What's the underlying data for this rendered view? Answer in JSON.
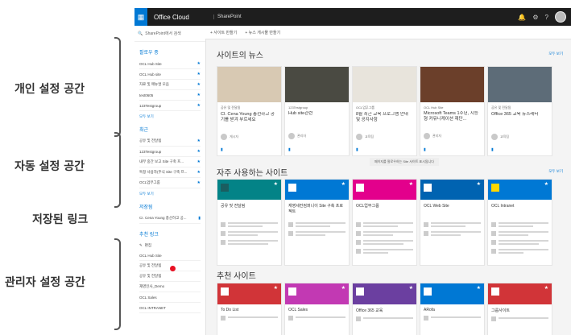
{
  "annotations": [
    {
      "label": "개인 설정 공간"
    },
    {
      "label": "자동 설정 공간"
    },
    {
      "label": "저장된 링크"
    },
    {
      "label": "관리자 설정 공간"
    }
  ],
  "topbar": {
    "brand": "Office Cloud",
    "site_title": "SharePoint",
    "icon_names": [
      "waffle-icon",
      "bell-icon",
      "gear-icon",
      "help-icon",
      "avatar"
    ]
  },
  "sidebar": {
    "search_placeholder": "SharePoint에서 검색",
    "following": {
      "title": "팔로우 중",
      "items": [
        "OCL Hub Site",
        "OCL Hub site",
        "자료 및 매뉴얼 모음",
        "test0605",
        "123Testgroup"
      ],
      "more": "모두 보기"
    },
    "recent": {
      "title": "최근",
      "items": [
        "공유 및 전달됨",
        "123Testgroup",
        "내부 중간 보고 Site 구축 프...",
        "특정 사용자(주식 Site 구축 프...",
        "OCL업무그룹"
      ],
      "more": "모두 보기"
    },
    "saved": {
      "title": "저장됨",
      "items": [
        "CI. Cena Young 총선하고 공..."
      ]
    },
    "featured": {
      "title": "추천 링크",
      "edit": "편집",
      "items": [
        "OCL Hub Site",
        "공유 및 전달됨",
        "공유 및 전달됨",
        "재영인사_Demo",
        "OCL Sales",
        "OCL INTRANET"
      ]
    }
  },
  "cmdbar": {
    "create_site": "+ 사이트 만들기",
    "create_news": "+ 뉴스 게시물 만들기"
  },
  "news": {
    "title": "사이트의 뉴스",
    "see_all": "모두 보기",
    "cards": [
      {
        "tag": "공유 및 전달됨",
        "title": "CI. Cena Young 총선하고 공기를 받겨 부르세요",
        "author": "게시자",
        "color": "#d8c9b3"
      },
      {
        "tag": "123Testgroup",
        "title": "Hub site관련",
        "author": "관리자",
        "color": "#4a4a42"
      },
      {
        "tag": "OCL업무그룹",
        "title": "8월 최근 교육 프로그램 안내 및 공지사항",
        "author": "교육팀",
        "color": "#e8e4dc"
      },
      {
        "tag": "OCL Hub Site",
        "title": "Microsoft Teams 1주년, 지능형 커뮤니케이션 재단...",
        "author": "관리자",
        "color": "#6b3f2a"
      },
      {
        "tag": "공유 및 전달됨",
        "title": "Office 365 교육 뉴스레터",
        "author": "교육팀",
        "color": "#5d6c78"
      }
    ]
  },
  "toast": "페이지를 팔로우하는 Site 사이트 표시됩니다",
  "frequent": {
    "title": "자주 사용하는 사이트",
    "see_all": "모두 보기",
    "sites": [
      {
        "name": "공유 및 전달됨",
        "color": "#038387",
        "logo": "#1a5e60"
      },
      {
        "name": "재영세컨컴퍼니이 Site 구축 프로젝트",
        "color": "#0078d4",
        "logo": "#ffffff"
      },
      {
        "name": "OCL업무그룹",
        "color": "#e3008c",
        "logo": "#ffffff"
      },
      {
        "name": "OCL Web Site",
        "color": "#0063b1",
        "logo": "#ffffff"
      },
      {
        "name": "OCL Intranet",
        "color": "#0078d4",
        "logo": "#ffd800"
      }
    ]
  },
  "recommended": {
    "title": "추천 사이트",
    "sites": [
      {
        "name": "To Do List",
        "color": "#d13438"
      },
      {
        "name": "OCL Sales",
        "color": "#c239b3"
      },
      {
        "name": "Office 365 교육",
        "color": "#6b3fa0"
      },
      {
        "name": "ARofa",
        "color": "#0078d4"
      },
      {
        "name": "그룹사이트",
        "color": "#d13438"
      }
    ]
  }
}
